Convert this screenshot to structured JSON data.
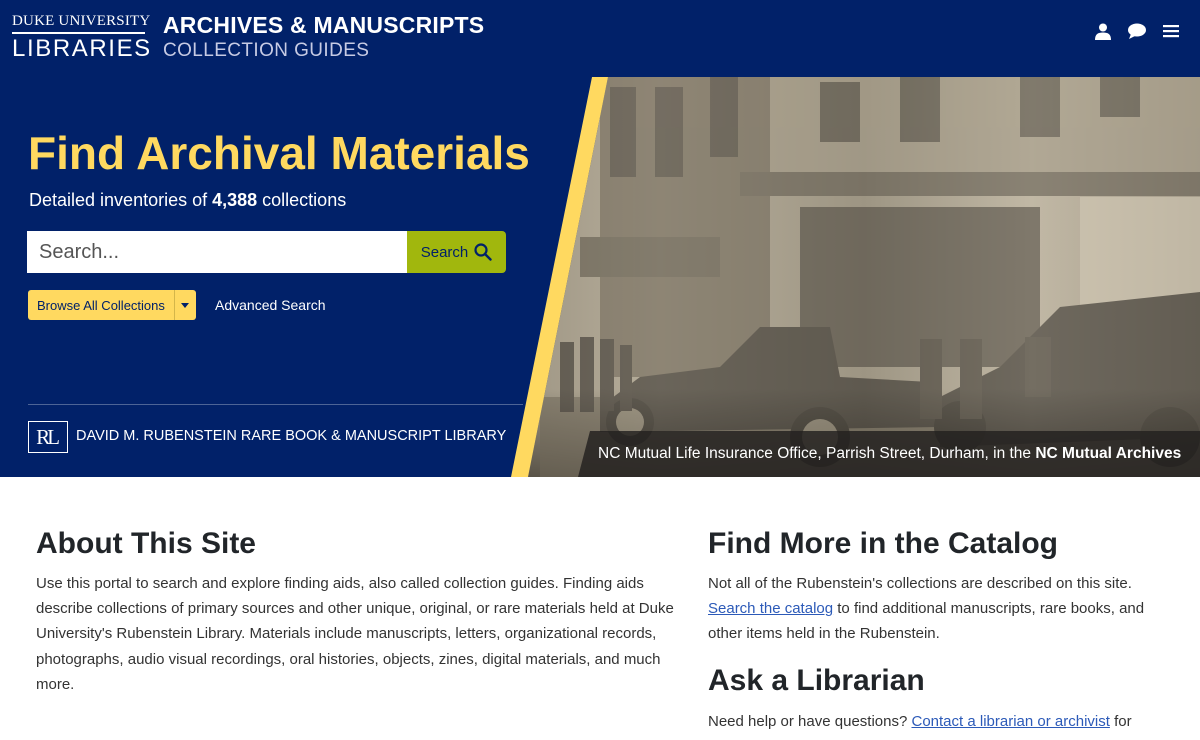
{
  "header": {
    "logo_top": "DUKE UNIVERSITY",
    "logo_bottom": "LIBRARIES",
    "title": "ARCHIVES & MANUSCRIPTS",
    "subtitle": "COLLECTION GUIDES",
    "icons": [
      "user-icon",
      "chat-icon",
      "menu-icon"
    ]
  },
  "hero": {
    "title": "Find Archival Materials",
    "sub_prefix": "Detailed inventories of ",
    "collection_count": "4,388",
    "sub_suffix": " collections",
    "search_placeholder": "Search...",
    "search_button": "Search",
    "browse_button": "Browse All Collections",
    "advanced_search": "Advanced Search",
    "library_logo": "RL",
    "library_name": "DAVID M. RUBENSTEIN RARE BOOK & MANUSCRIPT LIBRARY",
    "caption_prefix": "NC Mutual Life Insurance Office, Parrish Street, Durham, in the ",
    "caption_bold": "NC Mutual Archives"
  },
  "about": {
    "title": "About This Site",
    "text": "Use this portal to search and explore finding aids, also called collection guides. Finding aids describe collections of primary sources and other unique, original, or rare materials held at Duke University's Rubenstein Library. Materials include manuscripts, letters, organizational records, photographs, audio visual recordings, oral histories, objects, zines, digital materials, and much more."
  },
  "catalog": {
    "title": "Find More in the Catalog",
    "text_prefix": "Not all of the Rubenstein's collections are described on this site. ",
    "link": "Search the catalog",
    "text_suffix": " to find additional manuscripts, rare books, and other items held in the Rubenstein."
  },
  "ask": {
    "title": "Ask a Librarian",
    "text_prefix": "Need help or have questions? ",
    "link": "Contact a librarian or archivist",
    "text_suffix": " for"
  },
  "colors": {
    "navy": "#012169",
    "gold": "#ffd960",
    "search_green": "#a1b70d",
    "link_blue": "#2c5ab8"
  }
}
